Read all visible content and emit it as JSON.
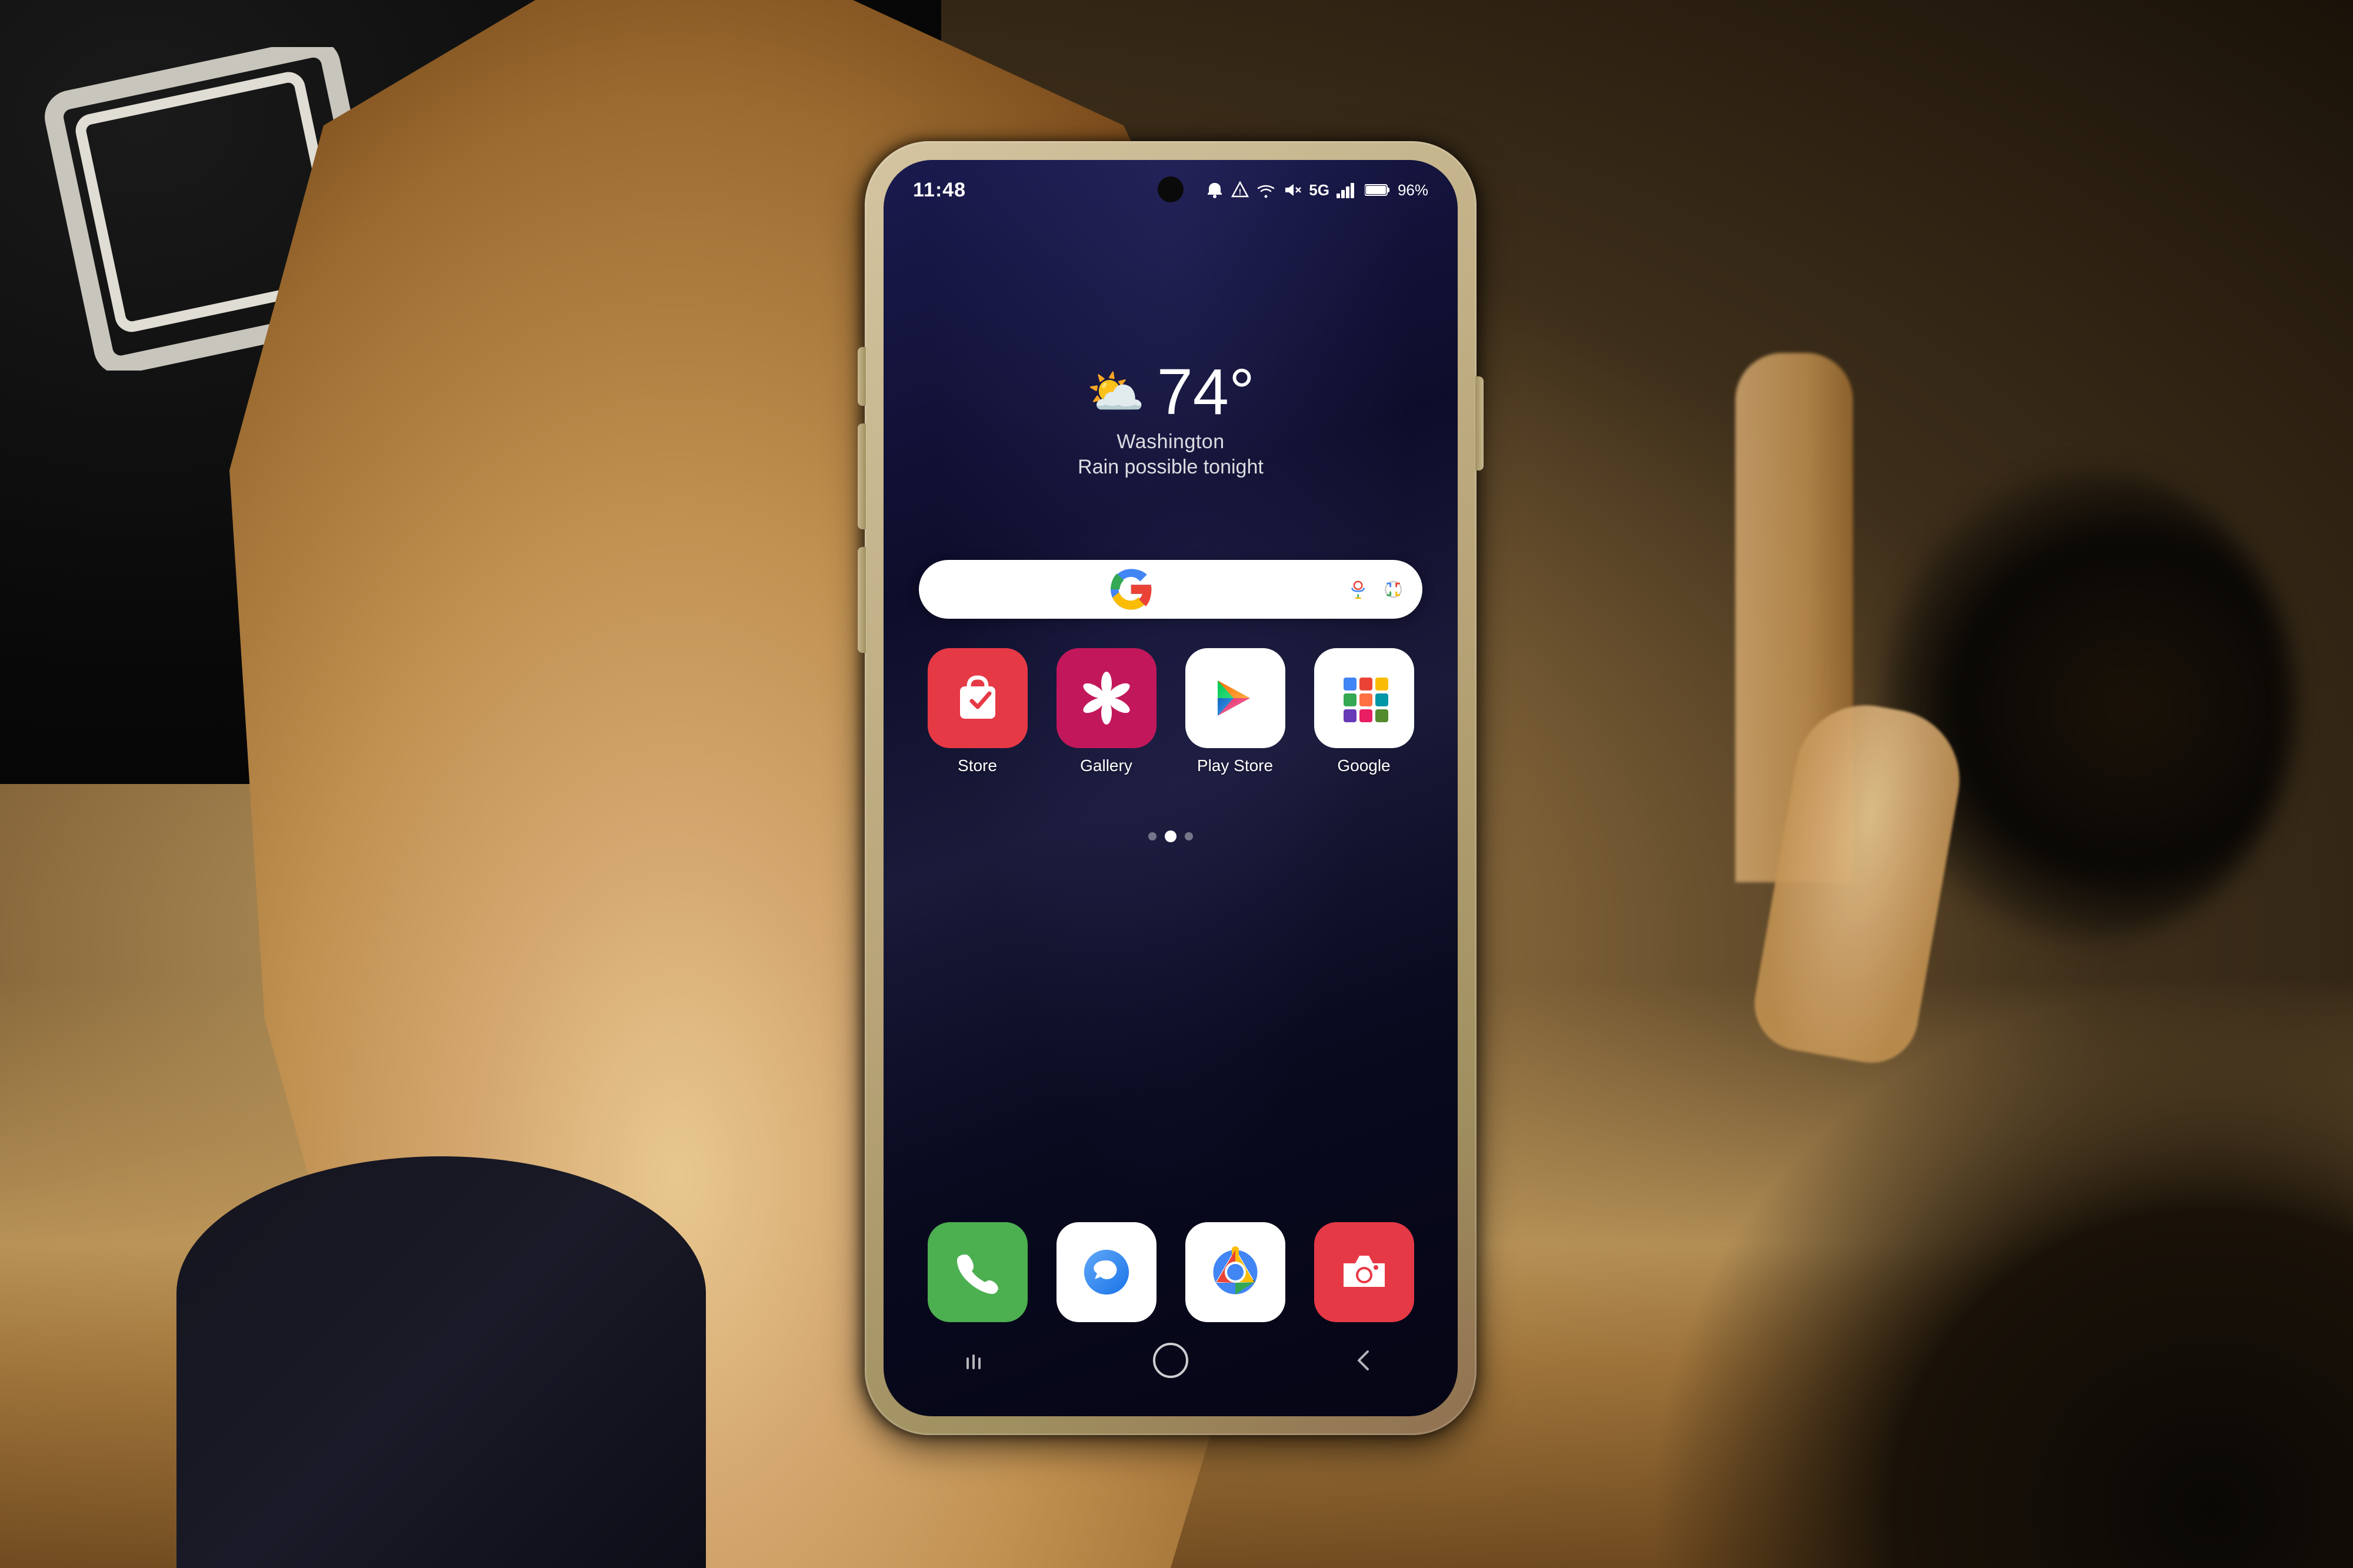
{
  "background": {
    "description": "Photo of hand holding Samsung Galaxy phone"
  },
  "phone": {
    "status_bar": {
      "time": "11:48",
      "notifications": [
        "bell-icon",
        "triangle-icon",
        "wifi-icon"
      ],
      "right_icons": {
        "volume": "muted",
        "network": "5G",
        "signal_bars": 4,
        "battery_percent": "96%",
        "battery_icon": "battery"
      }
    },
    "wallpaper": {
      "gradient_start": "#1a1a4e",
      "gradient_end": "#050515"
    },
    "weather_widget": {
      "icon": "☁️",
      "temperature": "74°",
      "location": "Washington",
      "description": "Rain possible tonight"
    },
    "search_bar": {
      "placeholder": "",
      "google_g_colors": [
        "#4285F4",
        "#EA4335",
        "#FBBC05",
        "#34A853"
      ]
    },
    "app_grid": {
      "row1": [
        {
          "name": "Store",
          "bg_color": "#e63946",
          "icon_type": "samsung-store"
        },
        {
          "name": "Gallery",
          "bg_color": "#c2185b",
          "icon_type": "galaxy-gallery"
        },
        {
          "name": "Play Store",
          "bg_color": "#ffffff",
          "icon_type": "play-store"
        },
        {
          "name": "Google",
          "bg_color": "#ffffff",
          "icon_type": "google-grid"
        }
      ]
    },
    "page_dots": [
      {
        "active": false
      },
      {
        "active": true
      },
      {
        "active": false
      }
    ],
    "dock": [
      {
        "name": "Phone",
        "bg_color": "#4CAF50",
        "icon_type": "phone"
      },
      {
        "name": "Messages",
        "bg_color": "#ffffff",
        "icon_type": "messages"
      },
      {
        "name": "Chrome",
        "bg_color": "#ffffff",
        "icon_type": "chrome"
      },
      {
        "name": "Camera",
        "bg_color": "#e63946",
        "icon_type": "camera"
      }
    ],
    "nav_bar": {
      "back": "|||",
      "home": "○",
      "recent": "‹"
    }
  }
}
